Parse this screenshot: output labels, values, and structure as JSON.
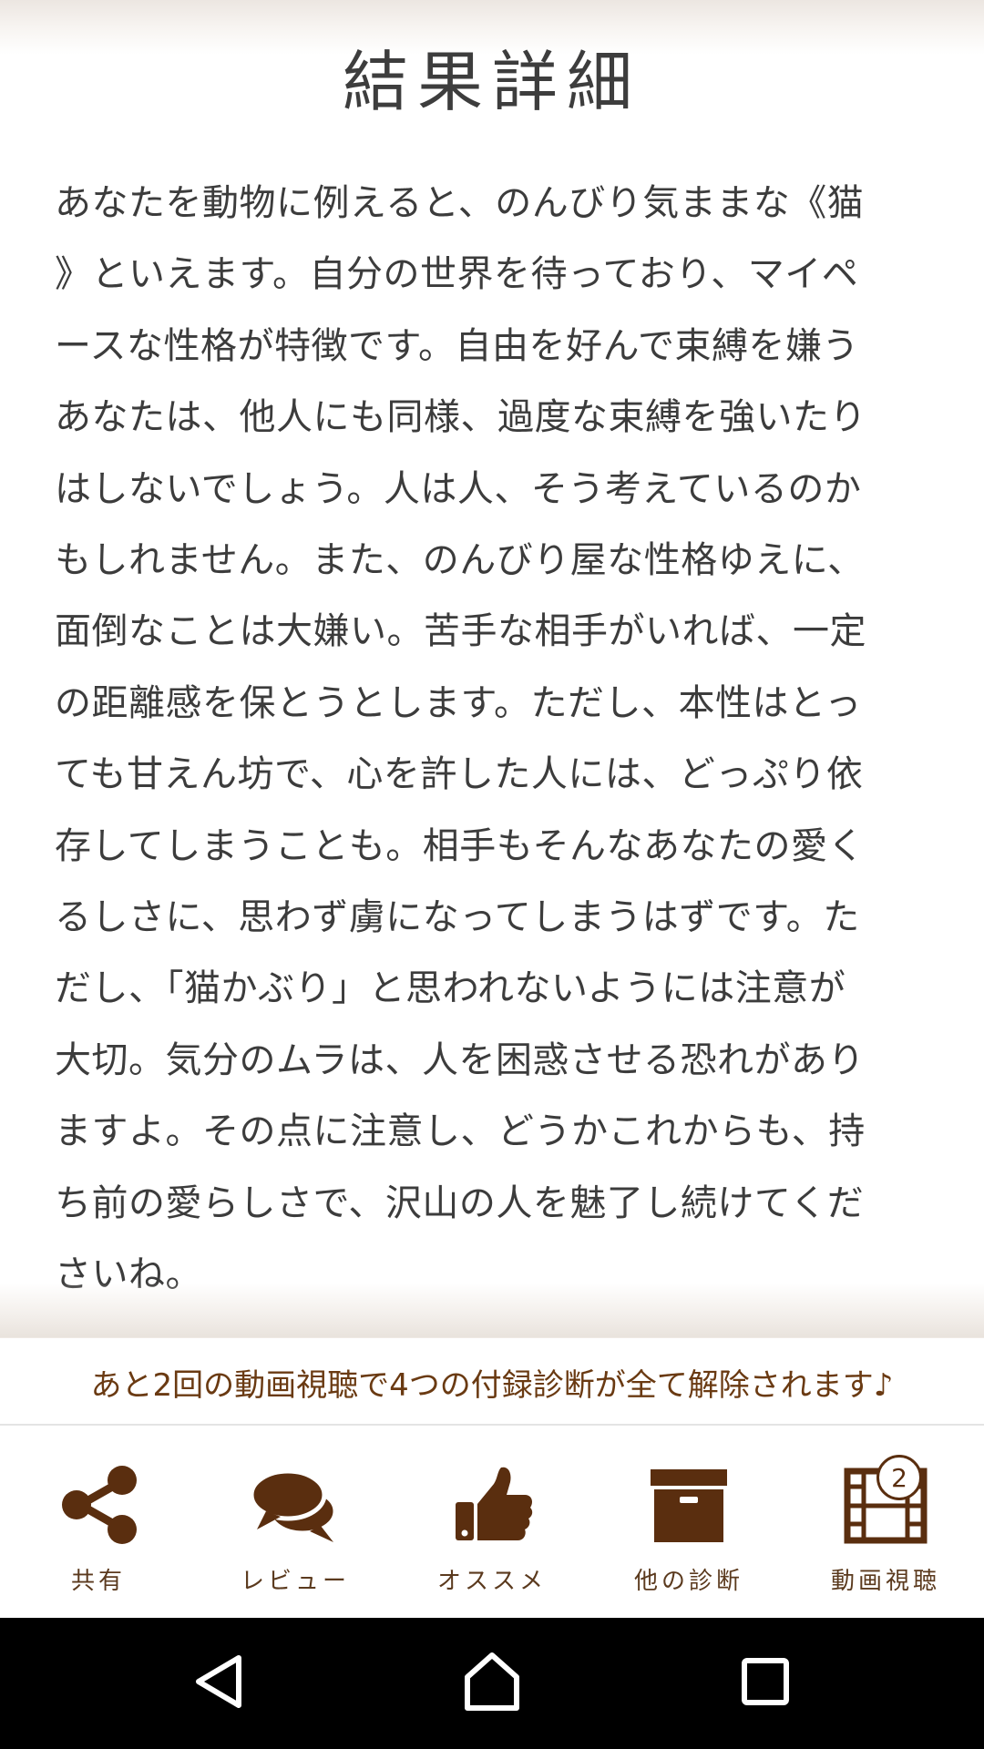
{
  "header": {
    "title": "結果詳細"
  },
  "result": {
    "text": "あなたを動物に例えると、のんびり気ままな《猫\n》といえます。自分の世界を待っており、マイペ\nースな性格が特徴です。自由を好んで束縛を嫌う\nあなたは、他人にも同様、過度な束縛を強いたり\nはしないでしょう。人は人、そう考えているのか\nもしれません。また、のんびり屋な性格ゆえに、\n面倒なことは大嫌い。苦手な相手がいれば、一定\nの距離感を保とうとします。ただし、本性はとっ\nても甘えん坊で、心を許した人には、どっぷり依\n存してしまうことも。相手もそんなあなたの愛く\nるしさに、思わず虜になってしまうはずです。た\nだし、「猫かぶり」と思われないようには注意が\n大切。気分のムラは、人を困惑させる恐れがあり\nますよ。その点に注意し、どうかこれからも、持\nち前の愛らしさで、沢山の人を魅了し続けてくだ\nさいね。"
  },
  "notice": {
    "text": "あと2回の動画視聴で4つの付録診断が全て解除されます♪"
  },
  "tabbar": {
    "items": [
      {
        "label": "共有",
        "icon": "share-icon"
      },
      {
        "label": "レビュー",
        "icon": "chat-bubbles-icon"
      },
      {
        "label": "オススメ",
        "icon": "thumbs-up-icon"
      },
      {
        "label": "他の診断",
        "icon": "archive-box-icon"
      },
      {
        "label": "動画視聴",
        "icon": "film-icon",
        "badge": "2"
      }
    ]
  },
  "colors": {
    "accent": "#5a2e0f",
    "text": "#3c3c3c",
    "notice": "#6a3a12"
  },
  "system_nav": {
    "buttons": [
      "back-icon",
      "home-icon",
      "recents-icon"
    ]
  }
}
